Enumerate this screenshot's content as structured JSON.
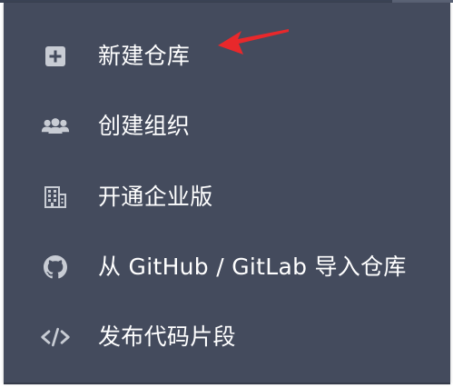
{
  "menu": {
    "items": [
      {
        "label": "新建仓库",
        "icon": "plus-square-icon"
      },
      {
        "label": "创建组织",
        "icon": "users-group-icon"
      },
      {
        "label": "开通企业版",
        "icon": "building-icon"
      },
      {
        "label": "从 GitHub / GitLab 导入仓库",
        "icon": "github-icon"
      },
      {
        "label": "发布代码片段",
        "icon": "code-icon"
      }
    ]
  },
  "colors": {
    "menu_background": "#444b5d",
    "icon_color": "#c8ccd4",
    "label_color": "#ffffff",
    "annotation_arrow": "#e8282b"
  }
}
